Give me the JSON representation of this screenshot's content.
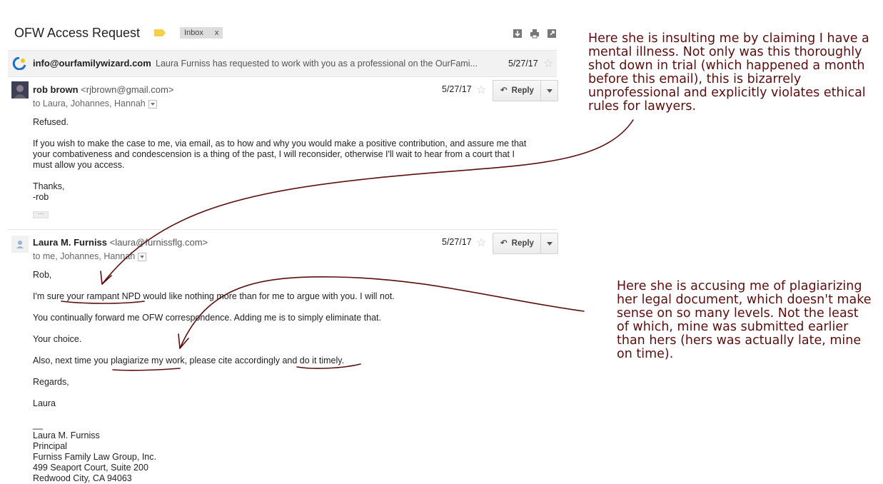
{
  "email": {
    "subject": "OFW Access Request",
    "label_chip": "Inbox",
    "label_chip_close": "x",
    "colors": {
      "label_tag": "#f5cf4b",
      "annotation": "#5c0e0e"
    }
  },
  "thread_row": {
    "from": "info@ourfamilywizard.com",
    "snippet": "Laura Furniss has requested to work with you as a professional on the OurFami...",
    "date": "5/27/17"
  },
  "messages": [
    {
      "sender_name": "rob brown",
      "sender_addr": "<rjbrown@gmail.com>",
      "to": "to Laura, Johannes, Hannah",
      "date": "5/27/17",
      "reply_label": "Reply",
      "body": [
        "Refused.",
        "If you wish to make the case to me, via email, as to how and why you would make a positive contribution, and assure me that",
        "your combativeness and condescension is a thing of the past, I will reconsider, otherwise I'll wait to hear from a court that I",
        "must allow you access.",
        "Thanks,",
        "-rob"
      ],
      "ellipsis": "···"
    },
    {
      "sender_name": "Laura M. Furniss",
      "sender_addr": "<laura@furnissflg.com>",
      "to": "to me, Johannes, Hannah",
      "date": "5/27/17",
      "reply_label": "Reply",
      "body": [
        "Rob,",
        "I'm sure your rampant NPD would like nothing more than for me to argue with you. I will not.",
        "You continually forward me OFW correspondence. Adding me is to simply eliminate that.",
        "Your choice.",
        "Also, next time you plagiarize my work, please cite accordingly and do it timely.",
        "Regards,",
        "Laura"
      ],
      "signature": [
        "__",
        "Laura M. Furniss",
        "Principal",
        "Furniss Family Law Group, Inc.",
        "499 Seaport Court, Suite 200",
        "Redwood City, CA 94063"
      ]
    }
  ],
  "annotations": [
    {
      "lines": [
        "Here she is insulting me by claiming I have a",
        "mental illness. Not only was this thoroughly",
        "shot down in trial (which happened a month",
        "before this email), this is bizarrely",
        "unprofessional and explicitly violates ethical",
        "rules for lawyers."
      ]
    },
    {
      "lines": [
        "Here she is accusing me of plagiarizing",
        "her legal document, which doesn't make",
        "sense on so many levels. Not the least",
        "of which, mine was submitted earlier",
        "than hers (hers was actually late, mine",
        "on time)."
      ]
    }
  ]
}
